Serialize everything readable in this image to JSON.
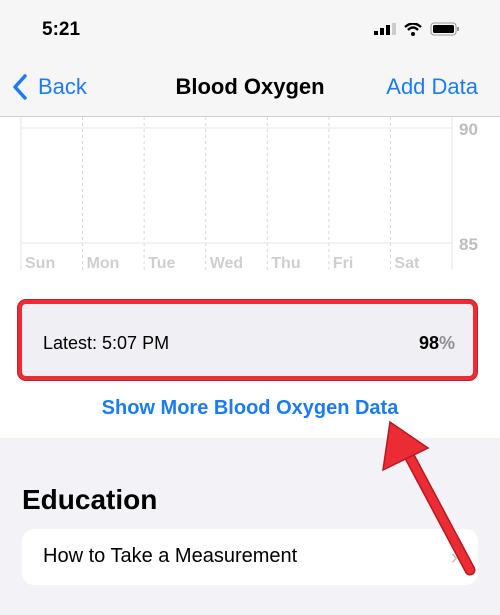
{
  "status_bar": {
    "time": "5:21"
  },
  "nav": {
    "back": "Back",
    "title": "Blood Oxygen",
    "add": "Add Data"
  },
  "chart_data": {
    "type": "line",
    "categories": [
      "Sun",
      "Mon",
      "Tue",
      "Wed",
      "Thu",
      "Fri",
      "Sat"
    ],
    "y_ticks": [
      "90",
      "85"
    ],
    "ylim": [
      85,
      90
    ],
    "series": [],
    "grid": true
  },
  "latest": {
    "label": "Latest: 5:07 PM",
    "value": "98",
    "unit": "%"
  },
  "show_more": "Show More Blood Oxygen Data",
  "education": {
    "title": "Education",
    "items": [
      {
        "label": "How to Take a Measurement"
      }
    ]
  },
  "colors": {
    "accent": "#1a7cf5",
    "highlight": "#ec2c35"
  }
}
